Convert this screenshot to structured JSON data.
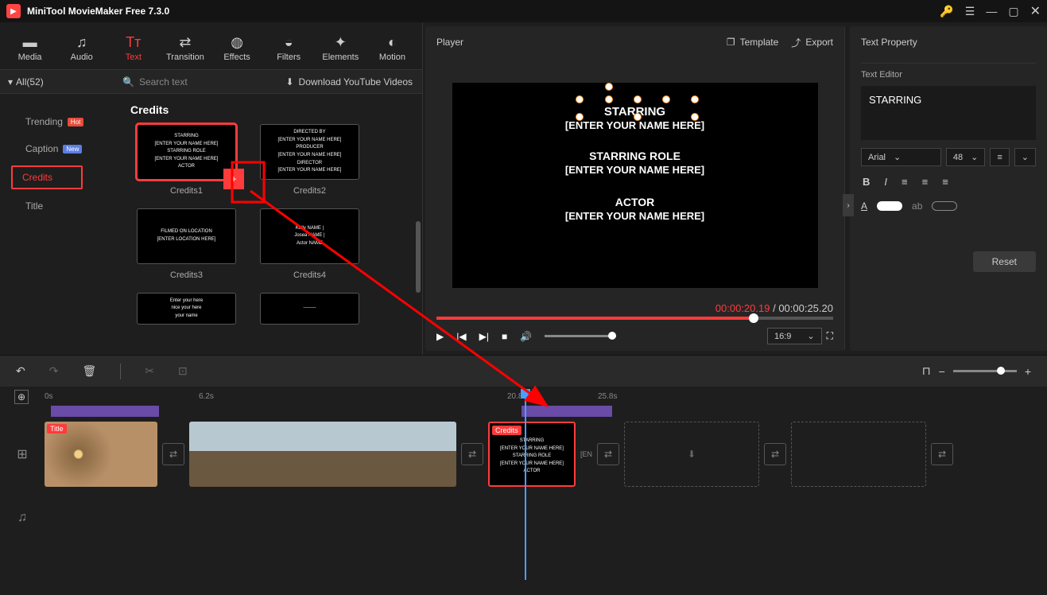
{
  "title": "MiniTool MovieMaker Free 7.3.0",
  "toolbar": {
    "media": "Media",
    "audio": "Audio",
    "text": "Text",
    "transition": "Transition",
    "effects": "Effects",
    "filters": "Filters",
    "elements": "Elements",
    "motion": "Motion"
  },
  "category": {
    "all_label": "All(52)",
    "search_placeholder": "Search text",
    "download_label": "Download YouTube Videos"
  },
  "sidebar": {
    "trending": "Trending",
    "caption": "Caption",
    "credits": "Credits",
    "title_cat": "Title",
    "hot": "Hot",
    "new": "New"
  },
  "assets": {
    "heading": "Credits",
    "cards": {
      "c1": {
        "label": "Credits1",
        "thumb": "STARRING\n[ENTER YOUR NAME HERE]\nSTARRING ROLE\n[ENTER YOUR NAME HERE]\nACTOR"
      },
      "c2": {
        "label": "Credits2",
        "thumb": "DIRECTED BY\n[ENTER YOUR NAME HERE]\nPRODUCER\n[ENTER YOUR NAME HERE]\nDIRECTOR\n[ENTER YOUR NAME HERE]"
      },
      "c3": {
        "label": "Credits3",
        "thumb": "FILMED ON LOCATION\n[ENTER LOCATION HERE]"
      },
      "c4": {
        "label": "Credits4",
        "thumb": "Kelly NAME |\nJosea NAME |\nActor NAME"
      },
      "c5": {
        "label": "",
        "thumb": "Enter your here\nnice your here\nyour name"
      },
      "c6": {
        "label": "",
        "thumb": "--------"
      }
    }
  },
  "player": {
    "header": "Player",
    "template_btn": "Template",
    "export_btn": "Export",
    "line1": "STARRING",
    "line2": "[ENTER YOUR NAME HERE]",
    "line3": "STARRING ROLE",
    "line4": "[ENTER YOUR NAME HERE]",
    "line5": "ACTOR",
    "line6": "[ENTER YOUR NAME HERE]",
    "time_current": "00:00:20.19",
    "time_sep": " / ",
    "time_total": "00:00:25.20",
    "aspect": "16:9"
  },
  "props": {
    "header": "Text Property",
    "editor_label": "Text Editor",
    "text_content": "STARRING",
    "font": "Arial",
    "size": "48",
    "reset": "Reset"
  },
  "timeline": {
    "ruler": {
      "t0": "0s",
      "t1": "6.2s",
      "t2": "20.8s",
      "t3": "25.8s"
    },
    "title_badge": "Title",
    "credits_badge": "Credits",
    "credit_mini": "STARRING\n[ENTER YOUR NAME HERE]\nSTARRING ROLE\n[ENTER YOUR NAME HERE]\nACTOR"
  }
}
